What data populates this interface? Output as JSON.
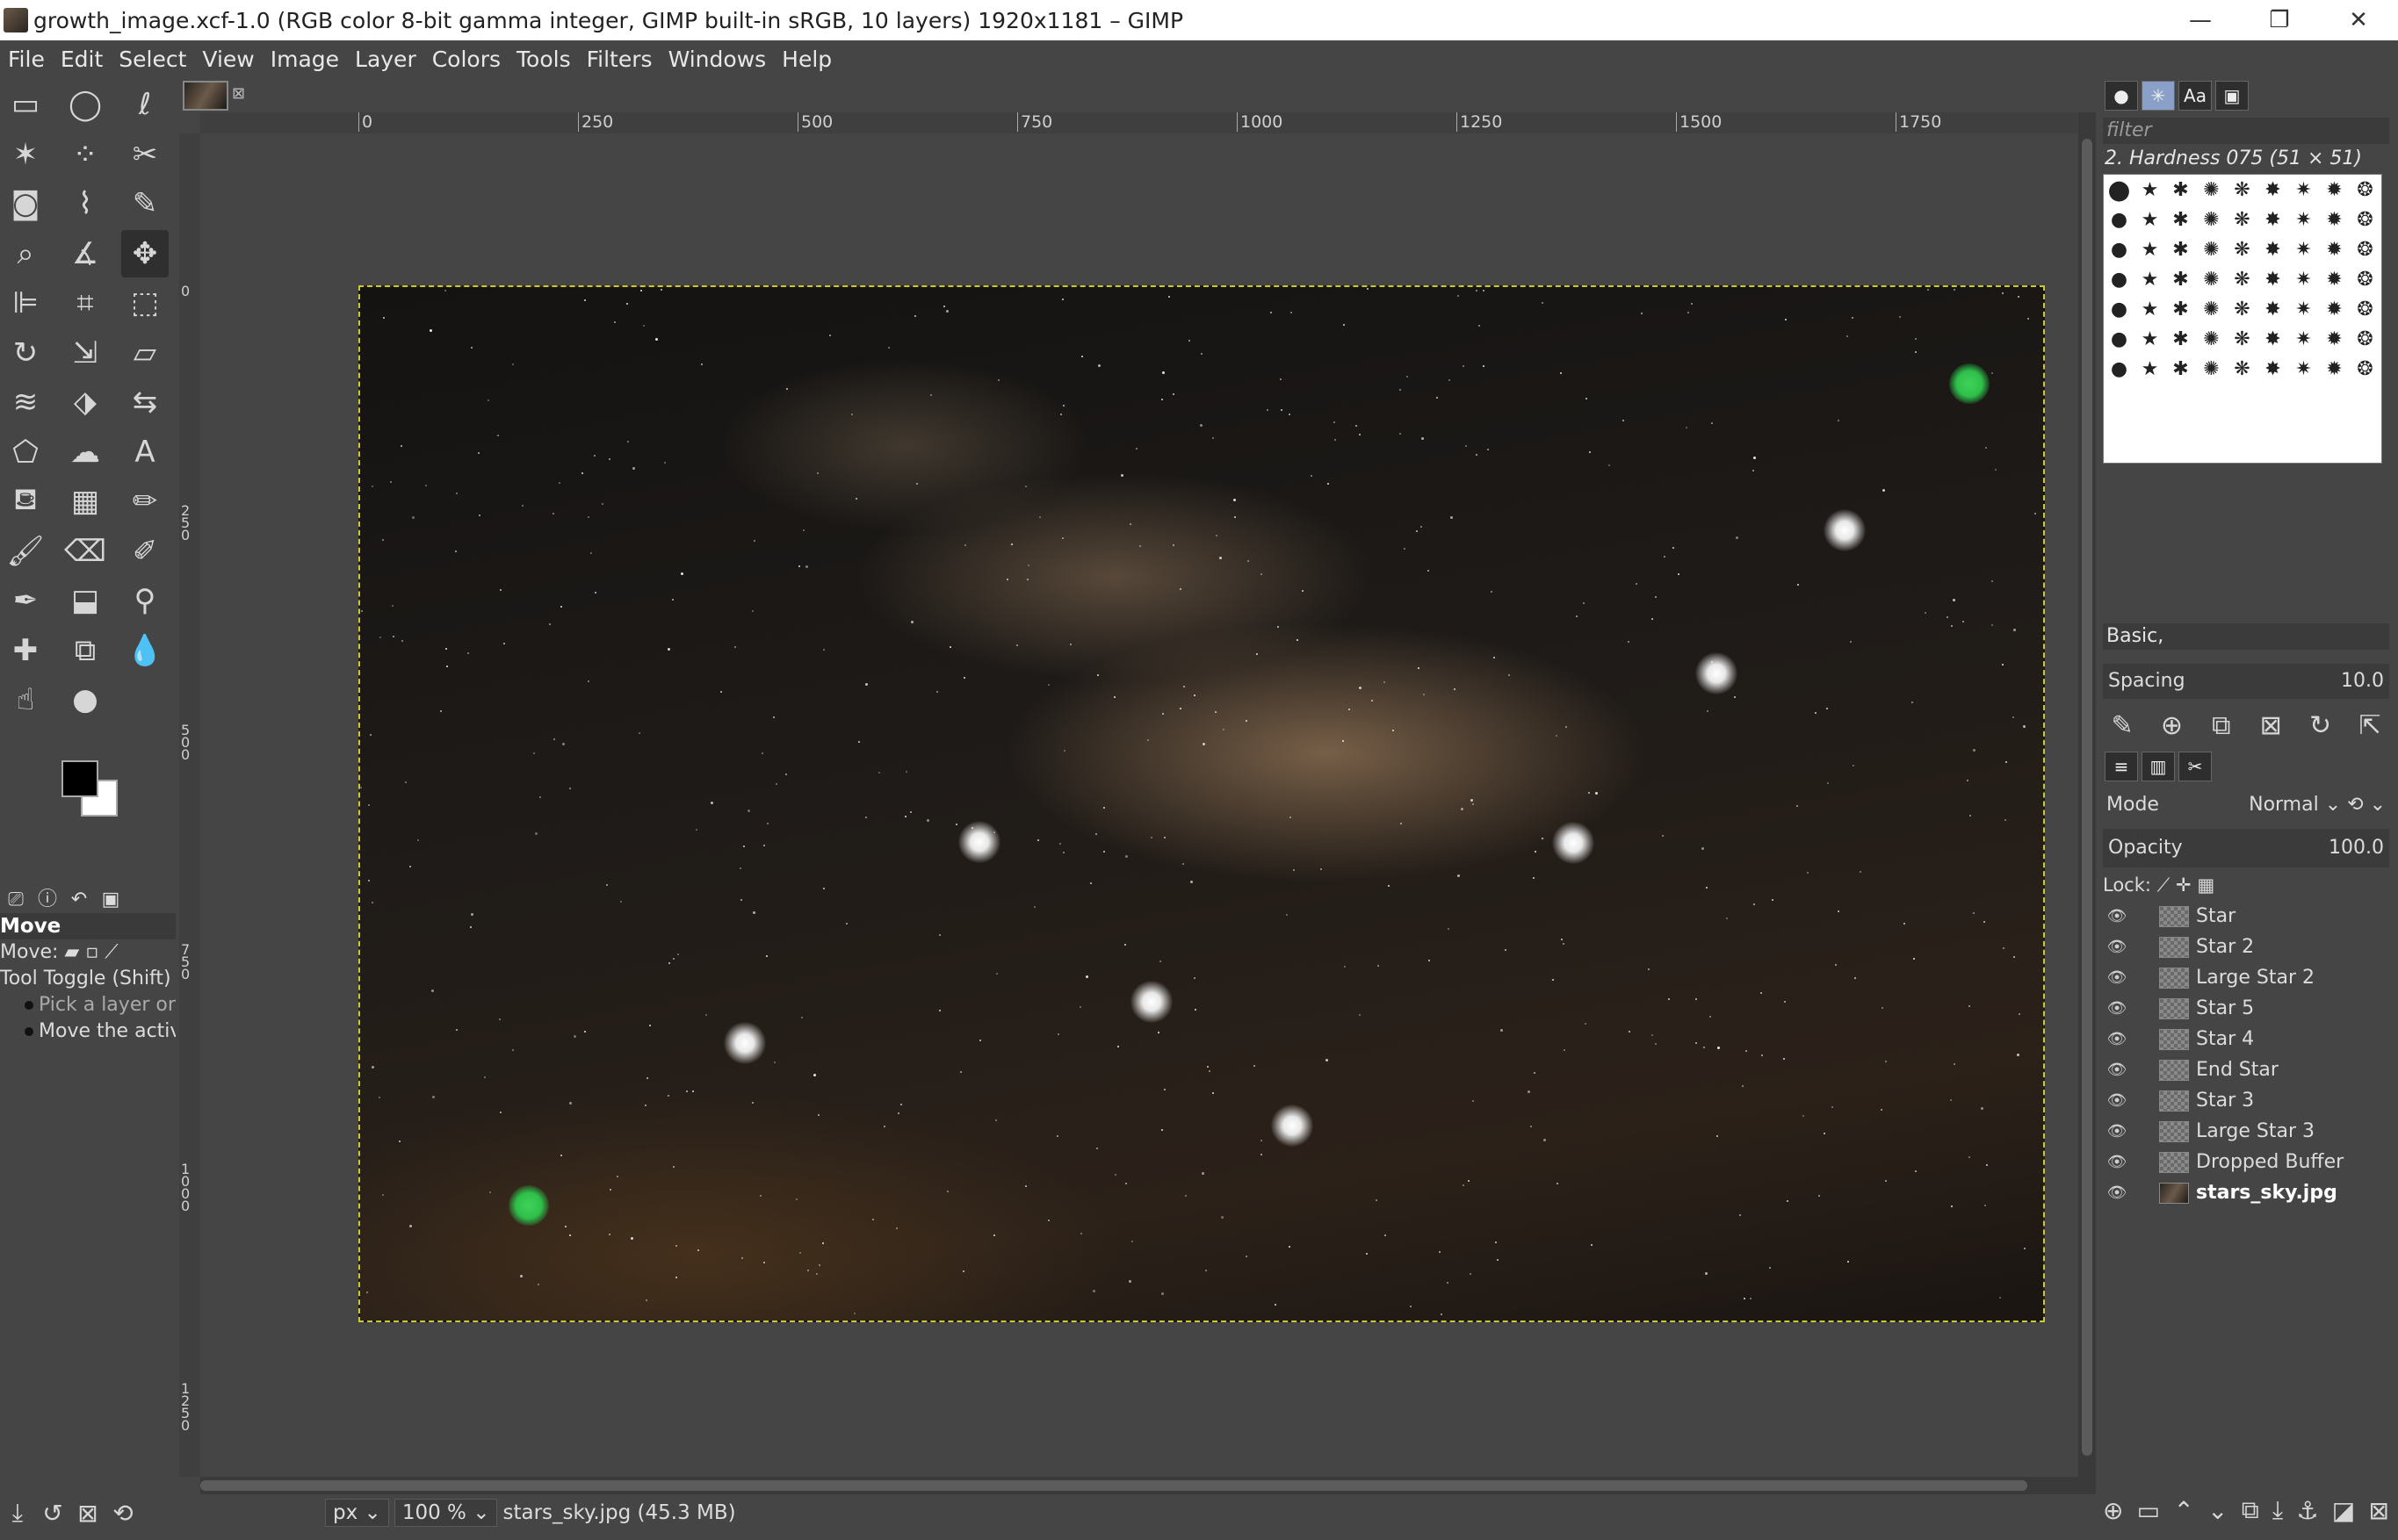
{
  "window": {
    "title": "growth_image.xcf-1.0 (RGB color 8-bit gamma integer, GIMP built-in sRGB, 10 layers) 1920x1181 – GIMP",
    "minimize": "—",
    "maximize": "❐",
    "close": "✕"
  },
  "menu": [
    "File",
    "Edit",
    "Select",
    "View",
    "Image",
    "Layer",
    "Colors",
    "Tools",
    "Filters",
    "Windows",
    "Help"
  ],
  "tools": [
    {
      "name": "rect-select",
      "glyph": "▭"
    },
    {
      "name": "ellipse-select",
      "glyph": "◯"
    },
    {
      "name": "free-select",
      "glyph": "ℓ"
    },
    {
      "name": "fuzzy-select",
      "glyph": "✶"
    },
    {
      "name": "color-select",
      "glyph": "⁘"
    },
    {
      "name": "scissors",
      "glyph": "✂"
    },
    {
      "name": "foreground-select",
      "glyph": "◙"
    },
    {
      "name": "paths",
      "glyph": "⌇"
    },
    {
      "name": "color-picker",
      "glyph": "✎"
    },
    {
      "name": "zoom",
      "glyph": "⌕"
    },
    {
      "name": "measure",
      "glyph": "∡"
    },
    {
      "name": "move",
      "glyph": "✥"
    },
    {
      "name": "align",
      "glyph": "⊫"
    },
    {
      "name": "crop",
      "glyph": "⌗"
    },
    {
      "name": "unified-transform",
      "glyph": "⬚"
    },
    {
      "name": "rotate",
      "glyph": "↻"
    },
    {
      "name": "scale",
      "glyph": "⇲"
    },
    {
      "name": "shear",
      "glyph": "▱"
    },
    {
      "name": "warp-transform",
      "glyph": "≋"
    },
    {
      "name": "perspective",
      "glyph": "⬗"
    },
    {
      "name": "flip",
      "glyph": "⇆"
    },
    {
      "name": "cage-transform",
      "glyph": "⬠"
    },
    {
      "name": "smudge-handle",
      "glyph": "☁"
    },
    {
      "name": "text",
      "glyph": "A"
    },
    {
      "name": "bucket-fill",
      "glyph": "⛾"
    },
    {
      "name": "gradient",
      "glyph": "▦"
    },
    {
      "name": "pencil",
      "glyph": "✏"
    },
    {
      "name": "paintbrush",
      "glyph": "🖌"
    },
    {
      "name": "eraser",
      "glyph": "⌫"
    },
    {
      "name": "airbrush",
      "glyph": "✐"
    },
    {
      "name": "ink",
      "glyph": "✒"
    },
    {
      "name": "mypaint-brush",
      "glyph": "⬓"
    },
    {
      "name": "clone",
      "glyph": "⚲"
    },
    {
      "name": "heal",
      "glyph": "✚"
    },
    {
      "name": "perspective-clone",
      "glyph": "⧉"
    },
    {
      "name": "blur",
      "glyph": "💧"
    },
    {
      "name": "smudge",
      "glyph": "☝"
    },
    {
      "name": "dodge",
      "glyph": "●"
    }
  ],
  "tool_options": {
    "title": "Move",
    "move_label": "Move:",
    "toggle": "Tool Toggle  (Shift)",
    "option1": "Pick a layer or g",
    "option2": "Move the active"
  },
  "rulers": {
    "h": [
      "0",
      "250",
      "500",
      "750",
      "1000",
      "1250",
      "1500",
      "1750"
    ],
    "v": [
      "0",
      "250",
      "500",
      "750",
      "1000",
      "1250"
    ]
  },
  "layers_dock": {
    "filter_placeholder": "filter",
    "brush_name": "2. Hardness 075 (51 × 51)",
    "preset": "Basic,",
    "spacing_label": "Spacing",
    "spacing_value": "10.0",
    "mode_label": "Mode",
    "mode_value": "Normal",
    "opacity_label": "Opacity",
    "opacity_value": "100.0",
    "lock_label": "Lock:",
    "layers": [
      "Star",
      "Star 2",
      "Large Star 2",
      "Star 5",
      "Star 4",
      "End Star",
      "Star 3",
      "Large Star 3",
      "Dropped Buffer",
      "stars_sky.jpg"
    ],
    "active_layer_index": 9
  },
  "status": {
    "unit": "px",
    "zoom": "100 %",
    "info": "stars_sky.jpg (45.3 MB)"
  },
  "canvas": {
    "stars": [
      {
        "kind": "green"
      },
      {
        "kind": "white"
      },
      {
        "kind": "white"
      },
      {
        "kind": "white"
      },
      {
        "kind": "white"
      },
      {
        "kind": "white"
      },
      {
        "kind": "white"
      },
      {
        "kind": "white"
      },
      {
        "kind": "green"
      }
    ]
  }
}
